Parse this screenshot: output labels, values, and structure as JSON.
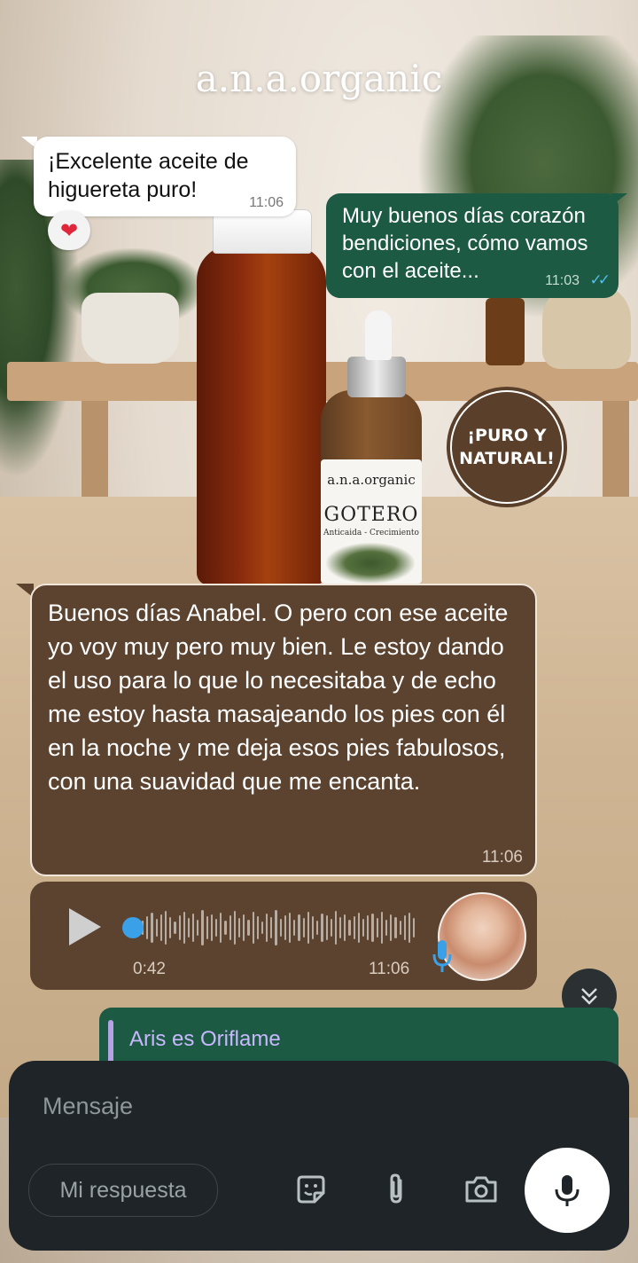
{
  "brand_title": "a.n.a.organic",
  "product_label": {
    "brand": "a.n.a.organic",
    "name": "GOTERO",
    "subtitle": "Anticaida - Crecimiento"
  },
  "badge": {
    "line1": "¡PURO Y",
    "line2": "NATURAL!"
  },
  "messages": [
    {
      "id": "m1",
      "type": "incoming",
      "text": "¡Excelente aceite de higuereta puro!",
      "time": "11:06",
      "reaction": "❤"
    },
    {
      "id": "m2",
      "type": "outgoing",
      "text": "Muy buenos días corazón bendiciones, cómo vamos con el aceite...",
      "time": "11:03",
      "status": "read"
    },
    {
      "id": "m3",
      "type": "incoming",
      "text": "Buenos días Anabel. O pero con ese aceite yo voy muy pero muy bien. Le estoy dando el uso para lo que lo necesitaba y de echo me estoy hasta masajeando los pies con él en la noche y me deja esos pies fabulosos, con una suavidad que me encanta.",
      "time": "11:06"
    },
    {
      "id": "m4",
      "type": "voice",
      "duration": "0:42",
      "time": "11:06",
      "progress": 0.0
    }
  ],
  "quoted_reply": {
    "name": "Aris es Oriflame"
  },
  "composer": {
    "placeholder": "Mensaje",
    "quick_reply": "Mi respuesta",
    "icons": [
      "sticker-icon",
      "attach-icon",
      "camera-icon",
      "mic-icon"
    ]
  },
  "colors": {
    "outgoing": "#1c5a44",
    "incoming_brown": "#5c4330",
    "read_ticks": "#53bdeb",
    "composer_bg": "#1e2427"
  }
}
